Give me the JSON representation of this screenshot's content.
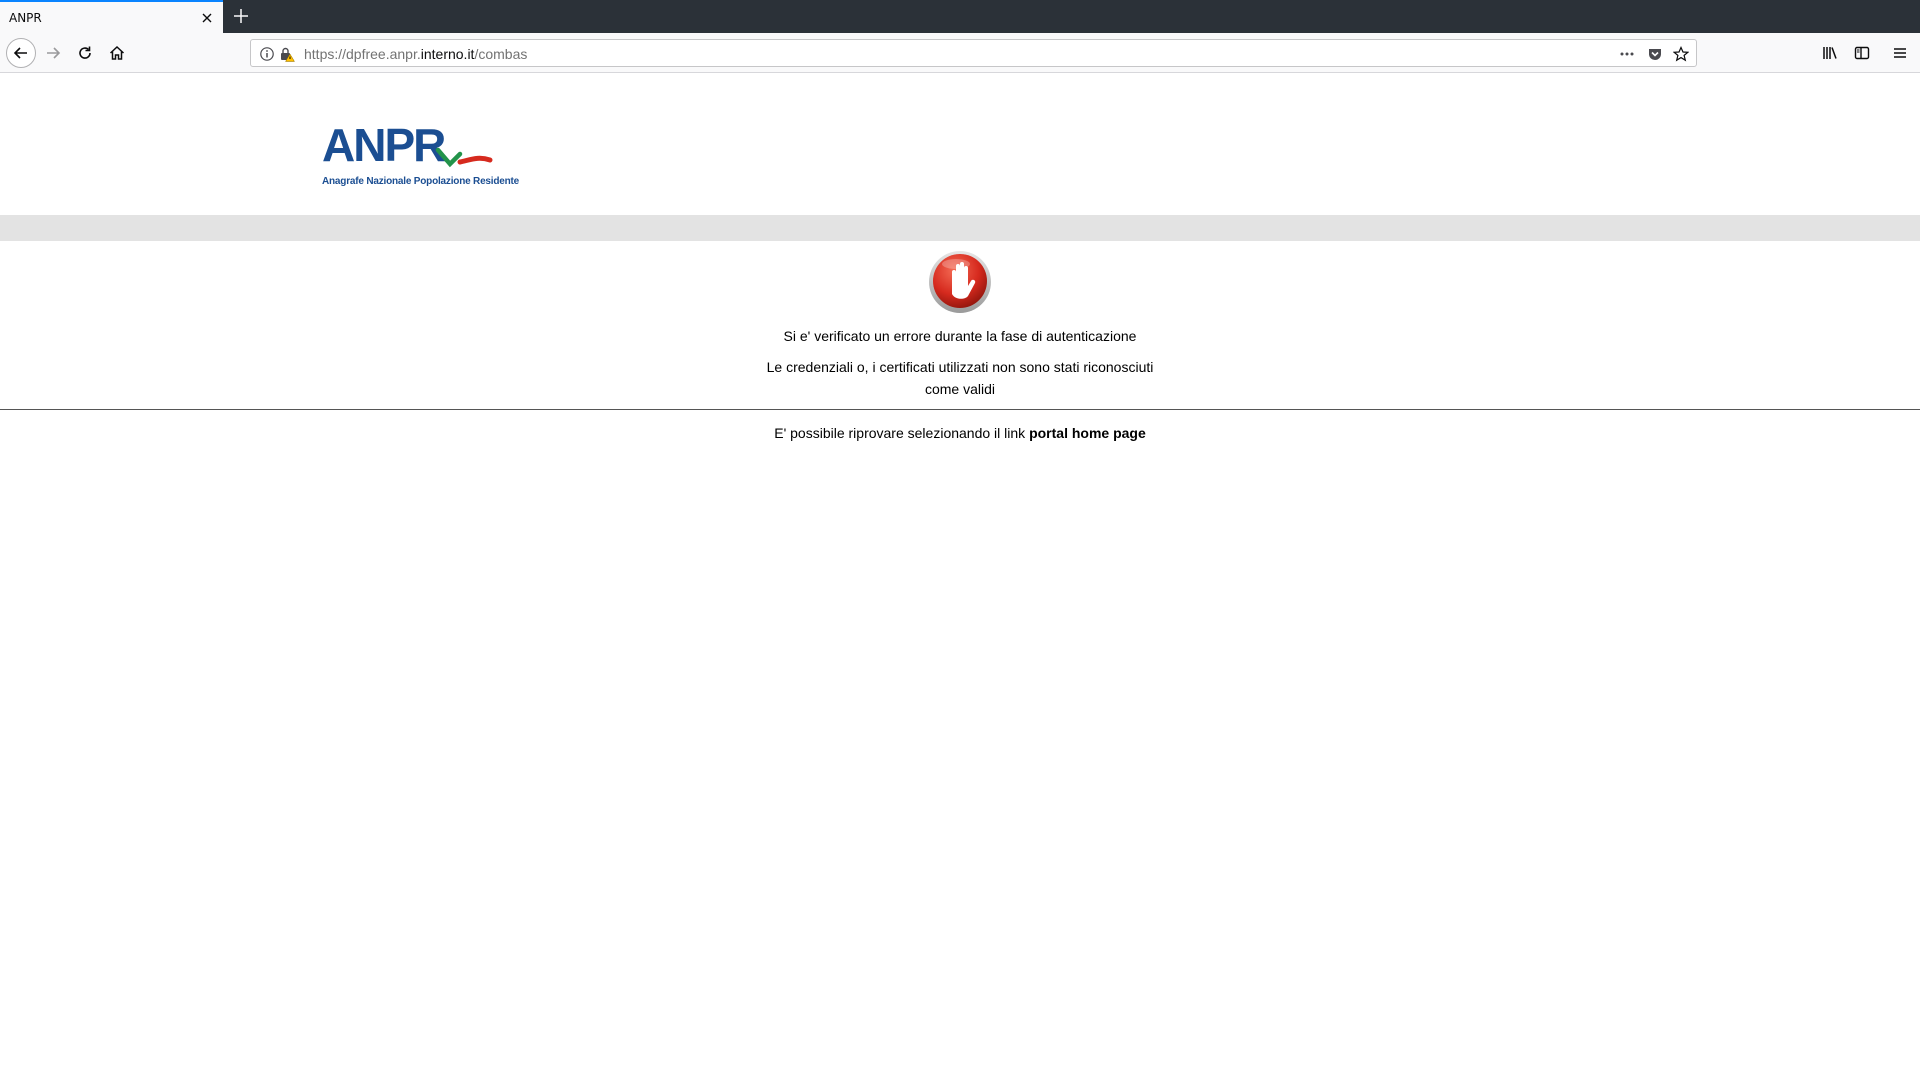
{
  "browser": {
    "tab_title": "ANPR",
    "url_prefix": "https://dpfree.anpr.",
    "url_host": "interno.it",
    "url_suffix": "/combas"
  },
  "logo": {
    "main_text": "ANPR",
    "subtitle": "Anagrafe Nazionale Popolazione Residente"
  },
  "content": {
    "error_title": "Si e' verificato un errore durante la fase di autenticazione",
    "error_detail_line1": "Le credenziali o, i certificati utilizzati non sono stati riconosciuti",
    "error_detail_line2": "come validi",
    "retry_text": "E' possibile riprovare selezionando il link ",
    "retry_link": "portal home page"
  },
  "colors": {
    "brand_blue": "#1b4e92",
    "brand_green": "#22934a",
    "brand_red": "#d62a1e",
    "tab_accent": "#0a84ff"
  },
  "icons": [
    "close-icon",
    "plus-icon",
    "back-arrow-icon",
    "forward-arrow-icon",
    "reload-icon",
    "home-icon",
    "info-icon",
    "lock-warning-icon",
    "more-icon",
    "pocket-icon",
    "star-icon",
    "library-icon",
    "sidebar-icon",
    "menu-icon",
    "stop-hand-icon"
  ]
}
